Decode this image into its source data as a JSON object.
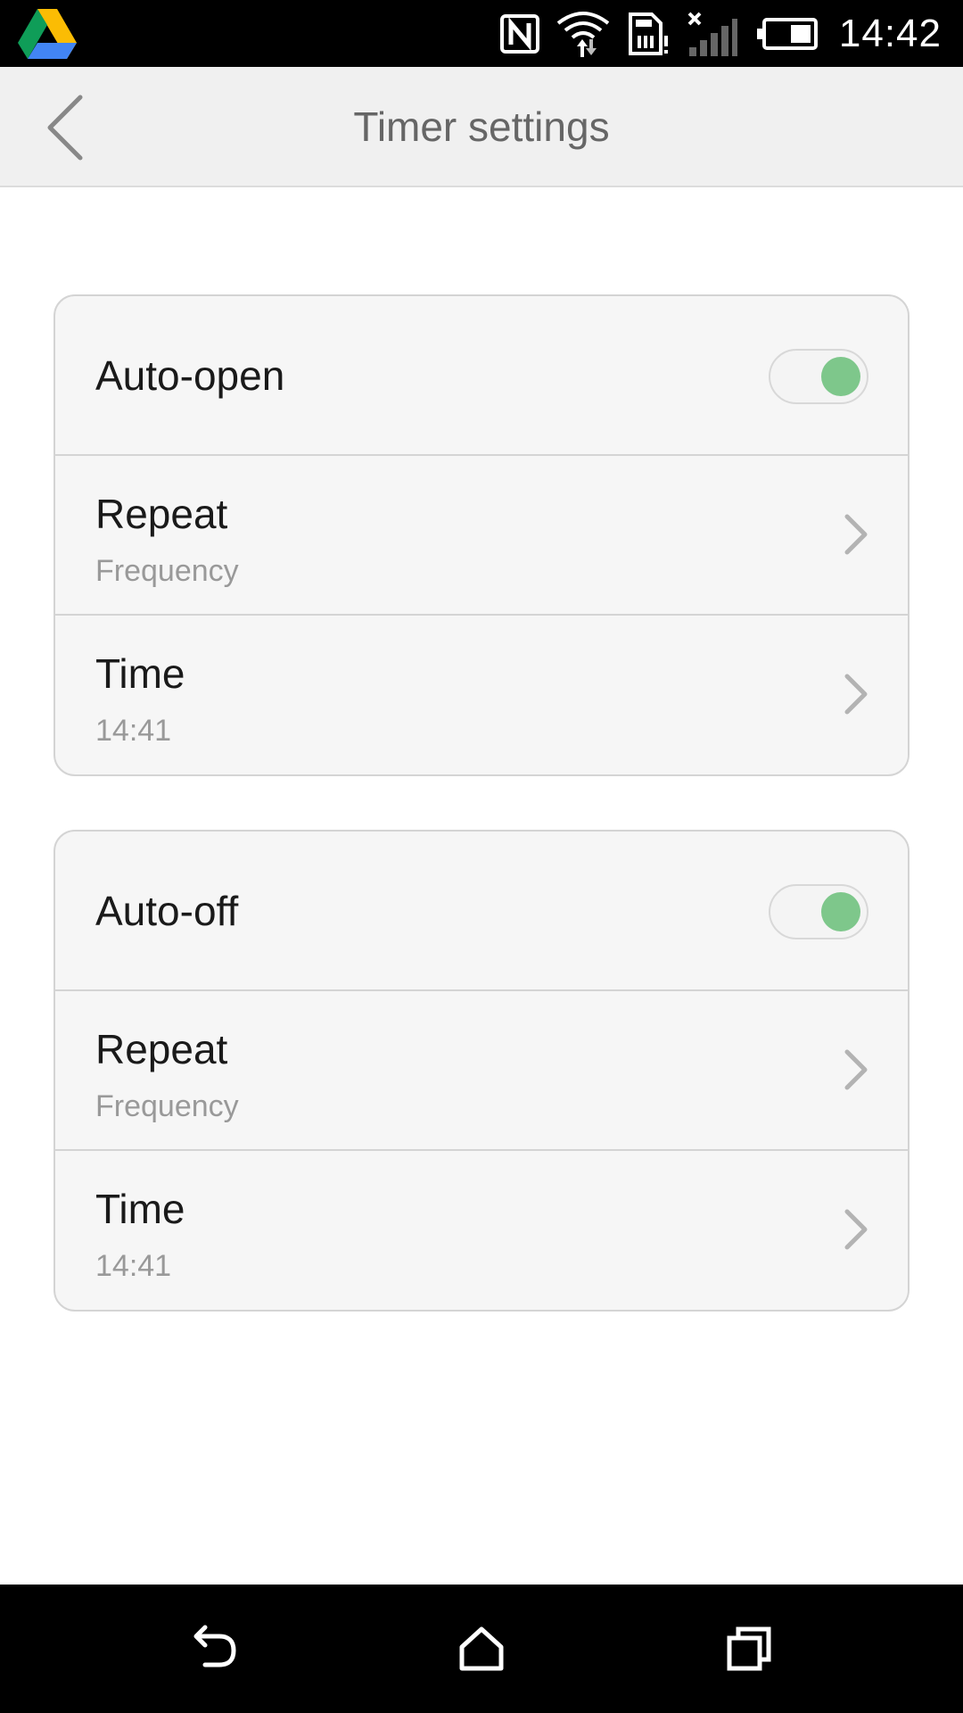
{
  "status_bar": {
    "time": "14:42",
    "icons": [
      "google-drive-icon",
      "nfc-icon",
      "wifi-icon",
      "sim-icon",
      "signal-icon",
      "battery-icon"
    ]
  },
  "header": {
    "title": "Timer settings",
    "back_icon": "chevron-left-icon"
  },
  "sections": [
    {
      "toggle_label": "Auto-open",
      "toggle_on": true,
      "rows": [
        {
          "label": "Repeat",
          "value": "Frequency"
        },
        {
          "label": "Time",
          "value": "14:41"
        }
      ]
    },
    {
      "toggle_label": "Auto-off",
      "toggle_on": true,
      "rows": [
        {
          "label": "Repeat",
          "value": "Frequency"
        },
        {
          "label": "Time",
          "value": "14:41"
        }
      ]
    }
  ],
  "nav_bar": {
    "icons": [
      "back-icon",
      "home-icon",
      "recent-apps-icon"
    ]
  },
  "colors": {
    "toggle_on": "#7ec78b",
    "card_bg": "#f6f6f6",
    "title_bar_bg": "#f0f0f0",
    "chevron": "#b3b3b3"
  }
}
